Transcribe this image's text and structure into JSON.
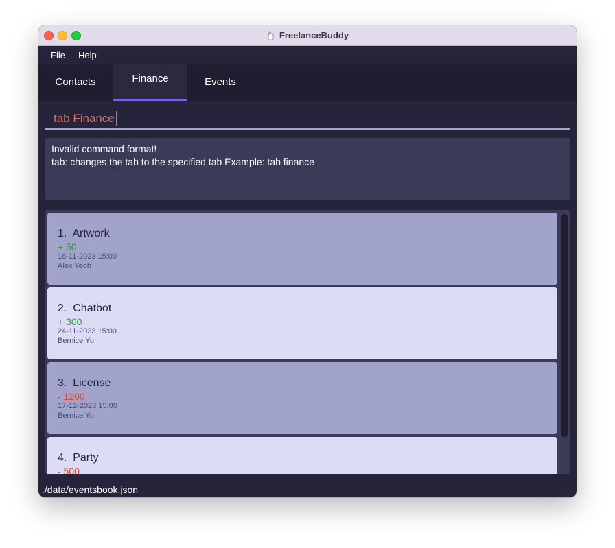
{
  "window": {
    "title": "FreelanceBuddy"
  },
  "menu": {
    "file": "File",
    "help": "Help"
  },
  "tabs": [
    {
      "label": "Contacts",
      "active": false
    },
    {
      "label": "Finance",
      "active": true
    },
    {
      "label": "Events",
      "active": false
    }
  ],
  "command": {
    "value": "tab Finance"
  },
  "result": {
    "line1": "Invalid command format!",
    "line2": "tab: changes the tab to the specified tab Example: tab finance"
  },
  "finances": [
    {
      "index": "1.",
      "title": "Artwork",
      "amount": "+ 50",
      "date": "18-11-2023 15:00",
      "person": "Alex Yeoh"
    },
    {
      "index": "2.",
      "title": "Chatbot",
      "amount": "+ 300",
      "date": "24-11-2023 15:00",
      "person": "Bernice Yu"
    },
    {
      "index": "3.",
      "title": "License",
      "amount": "- 1200",
      "date": "17-12-2023 15:00",
      "person": "Bernice Yu"
    },
    {
      "index": "4.",
      "title": "Party",
      "amount": "- 500",
      "date": "",
      "person": ""
    }
  ],
  "status": {
    "path": "./data/eventsbook.json"
  },
  "colors": {
    "accent": "#7c5cf0",
    "income": "#2e9e3c",
    "expense": "#d9453a",
    "command_error_text": "#e66a59"
  }
}
